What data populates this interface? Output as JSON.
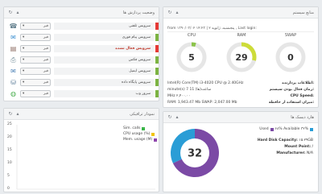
{
  "services_panel": {
    "title": "وضعیت پردازش ها",
    "items": [
      {
        "label": "سرویس تلفنی",
        "status": "stopped",
        "btn": "قیر",
        "icon": "phone-icon",
        "bad": false
      },
      {
        "label": "سرویس پیام فوری",
        "status": "running",
        "btn": "قیر",
        "icon": "chat-icon",
        "bad": false
      },
      {
        "label": "سرویس فعال نشده",
        "status": "stopped",
        "btn": "قیر",
        "icon": "clipboard-icon",
        "bad": true
      },
      {
        "label": "سرویس فکس",
        "status": "running",
        "btn": "قیر",
        "icon": "fax-icon",
        "bad": false
      },
      {
        "label": "سرویس ایمیل",
        "status": "running",
        "btn": "قیر",
        "icon": "mail-icon",
        "bad": false
      },
      {
        "label": "سرویس پایگاه داده",
        "status": "running",
        "btn": "قیر",
        "icon": "database-icon",
        "bad": false
      },
      {
        "label": "سرور وب",
        "status": "running",
        "btn": "قیر",
        "icon": "globe-icon",
        "bad": false
      }
    ],
    "status_colors": {
      "running": "#7cb342",
      "stopped": "#e53935"
    }
  },
  "system_panel": {
    "title": "منابع سیستم",
    "login_text": "from ۱۳۹۰/۰۳/۰۲ ۱۴:۲۳ | ۲ پنجشنبه، ژانویه , Last login:",
    "gauges": [
      {
        "label": "CPU",
        "value": "5",
        "fraction": 0.05,
        "color": "#8bc34a"
      },
      {
        "label": "RAM",
        "value": "29",
        "fraction": 0.29,
        "color": "#cddc39"
      },
      {
        "label": "SWAP",
        "value": "0",
        "fraction": 0.0,
        "color": "#cddc39"
      }
    ],
    "info": [
      {
        "k": "اطلاعات پردازنده:",
        "v": "Intel(R) Core(TM) i3-4020 CPU @ 2.40GHz"
      },
      {
        "k": "زمان فعال بودن سیستم:",
        "v": "minute(s) 7 ساعت(ها) 11"
      },
      {
        "k": "CPU Speed:",
        "v": "MHz ۲,۴۰۰.۰۰"
      },
      {
        "k": "میزان استفاده از حافظه:",
        "v": "RAM: 1,943.47 Mb SWAP: 2,047.00 Mb"
      }
    ]
  },
  "traffic_panel": {
    "title": "نمودار ترافیکی",
    "y_ticks": [
      "25",
      "20",
      "15",
      "10",
      "5",
      "0"
    ],
    "legend": [
      {
        "name": "Sim. calls",
        "color": "#3bb54a"
      },
      {
        "name": "CPU usage (%)",
        "color": "#f1c40f"
      },
      {
        "name": "Mem. usage (M)",
        "color": "#8e44ad"
      }
    ]
  },
  "disks_panel": {
    "title": "هارد دیسک ها",
    "legend_text": "Used  ■ ۶۸% Available ۳۲%",
    "used_label": "Used",
    "available_label": "۶۸% Available ۳۲%",
    "pie_value": "32",
    "used_fraction": 0.68,
    "used_color": "#7b4aa5",
    "available_color": "#2a9dd6",
    "rows": [
      {
        "k": "Hard Disk Capacity:",
        "v": "۱۵.۲۹GB"
      },
      {
        "k": "Mount Point:",
        "v": "/"
      },
      {
        "k": "Manufacturer:",
        "v": "N/A"
      }
    ]
  }
}
